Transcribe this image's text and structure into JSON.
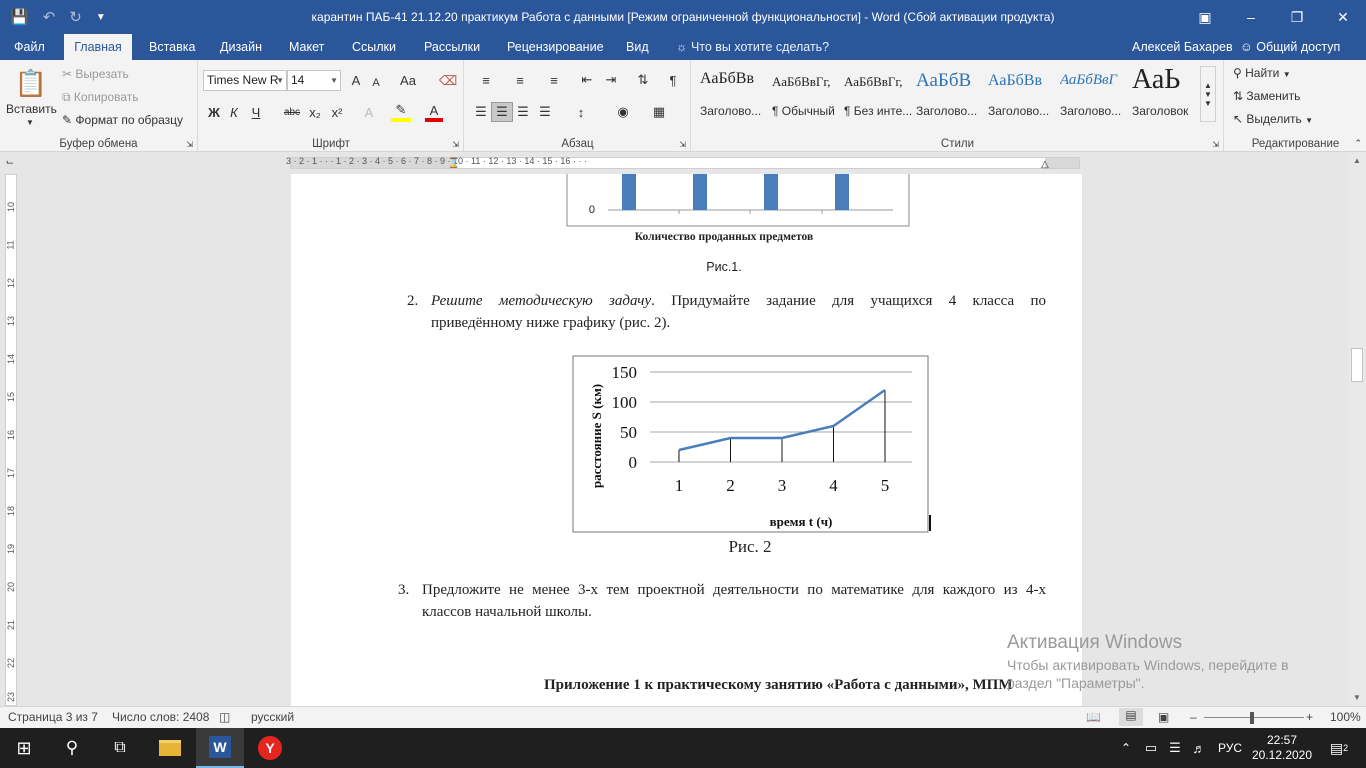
{
  "titlebar": {
    "title": "карантин ПАБ-41  21.12.20 практикум  Работа с данными [Режим ограниченной функциональности] - Word (Сбой активации продукта)"
  },
  "tabs": [
    "Файл",
    "Главная",
    "Вставка",
    "Дизайн",
    "Макет",
    "Ссылки",
    "Рассылки",
    "Рецензирование",
    "Вид"
  ],
  "tellme": "Что вы хотите сделать?",
  "user": "Алексей Бахарев",
  "share": "Общий доступ",
  "ribbon": {
    "clipboard": {
      "label": "Буфер обмена",
      "paste": "Вставить",
      "cut": "Вырезать",
      "copy": "Копировать",
      "format_painter": "Формат по образцу"
    },
    "font": {
      "label": "Шрифт",
      "name": "Times New R",
      "size": "14",
      "bold": "Ж",
      "italic": "К",
      "underline": "Ч",
      "strike": "abc",
      "sub": "x₂",
      "sup": "x²",
      "grow": "A",
      "shrink": "A",
      "case": "Aa"
    },
    "paragraph": {
      "label": "Абзац"
    },
    "styles": {
      "label": "Стили",
      "items": [
        {
          "sample": "АаБбВв",
          "name": "Заголово..."
        },
        {
          "sample": "АаБбВвГг,",
          "name": "¶ Обычный"
        },
        {
          "sample": "АаБбВвГг,",
          "name": "¶ Без инте..."
        },
        {
          "sample": "АаБбВ",
          "name": "Заголово..."
        },
        {
          "sample": "АаБбВв",
          "name": "Заголово..."
        },
        {
          "sample": "АаБбВвГ",
          "name": "Заголово..."
        },
        {
          "sample": "АаЬ",
          "name": "Заголовок"
        }
      ]
    },
    "editing": {
      "label": "Редактирование",
      "find": "Найти",
      "replace": "Заменить",
      "select": "Выделить"
    }
  },
  "ruler": {
    "h_numbers": "3 · 2 · 1 · · · 1 · 2 · 3 · 4 · 5 · 6 · 7 · 8 · 9 · 10 · 11 · 12 · 13 · 14 · 15 · 16 · · ·",
    "v_numbers": [
      "10",
      "11",
      "12",
      "13",
      "14",
      "15",
      "16",
      "17",
      "18",
      "19",
      "20",
      "21",
      "22",
      "23"
    ]
  },
  "document": {
    "chart1": {
      "caption_axis": "Количество проданных предметов",
      "fig": "Рис.1.",
      "zero_label": "0"
    },
    "item2": {
      "num": "2.",
      "italic": "Решите методическую задачу",
      "rest_line1": ". Придумайте задание для учащихся 4 класса по",
      "line2": "приведённому ниже графику (рис. 2)."
    },
    "fig2": "Рис. 2",
    "item3": {
      "num": "3.",
      "line1": "Предложите не менее 3-х тем проектной деятельности по математике для каждого из 4-х",
      "line2": "классов начальной школы."
    },
    "appendix": "Приложение 1 к практическому занятию «Работа с данными», МПМ"
  },
  "chart_data": [
    {
      "type": "bar",
      "categories": [
        "",
        "",
        "",
        ""
      ],
      "values": [
        null,
        null,
        null,
        null
      ],
      "xlabel": "Количество проданных предметов",
      "ylabel": "",
      "y_ticks": [
        "0"
      ],
      "colors": [
        "#4a7ebb"
      ]
    },
    {
      "type": "line",
      "x": [
        1,
        2,
        3,
        4,
        5
      ],
      "y": [
        20,
        40,
        40,
        60,
        120
      ],
      "xlabel": "время t (ч)",
      "ylabel": "расстояние S (км)",
      "ylim": [
        0,
        150
      ],
      "y_ticks": [
        0,
        50,
        100,
        150
      ],
      "grid": true,
      "drop_lines": true,
      "colors": [
        "#4a7ebb"
      ]
    }
  ],
  "status": {
    "page": "Страница 3 из 7",
    "words": "Число слов: 2408",
    "lang": "русский",
    "zoom": "100%"
  },
  "watermark": {
    "title": "Активация Windows",
    "line1": "Чтобы активировать Windows, перейдите в",
    "line2": "раздел \"Параметры\"."
  },
  "taskbar": {
    "lang": "РУС",
    "time": "22:57",
    "date": "20.12.2020",
    "notifications": "2"
  }
}
